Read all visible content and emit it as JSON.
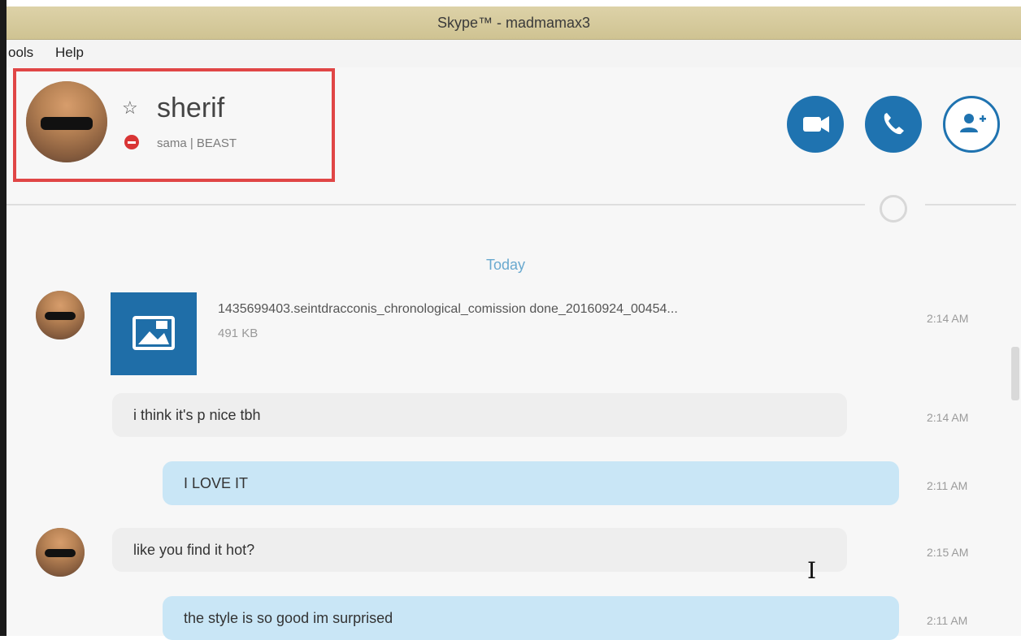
{
  "window": {
    "title": "Skype™ - madmamax3"
  },
  "menu": {
    "tools": "ools",
    "help": "Help"
  },
  "contact": {
    "name": "sherif",
    "mood": "sama | BEAST"
  },
  "conversation": {
    "date_separator": "Today",
    "file": {
      "name": "1435699403.seintdracconis_chronological_comission done_20160924_00454...",
      "size": "491 KB",
      "time": "2:14 AM"
    },
    "messages": [
      {
        "text": "i think it's p nice tbh",
        "time": "2:14 AM",
        "direction": "incoming"
      },
      {
        "text": "I LOVE IT",
        "time": "2:11 AM",
        "direction": "outgoing"
      },
      {
        "text": "like you find it hot?",
        "time": "2:15 AM",
        "direction": "incoming"
      },
      {
        "text": "the style is so good im surprised",
        "time": "2:11 AM",
        "direction": "outgoing"
      }
    ]
  },
  "colors": {
    "accent": "#1f73b0",
    "highlight": "#e04646",
    "status_busy": "#d93535",
    "outgoing_bubble": "#c9e6f6"
  }
}
